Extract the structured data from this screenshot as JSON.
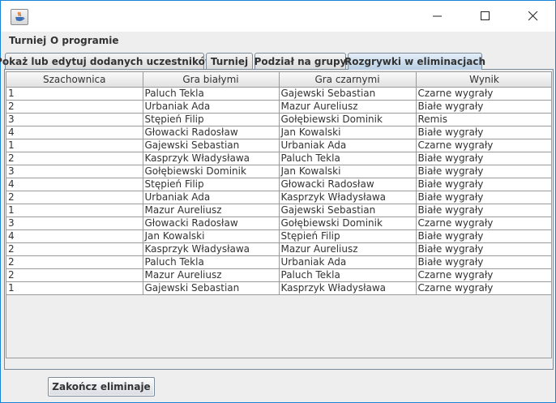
{
  "window": {
    "title": "",
    "icon": "java-cup-icon"
  },
  "menu": {
    "items": [
      "Turniej",
      "O programie"
    ]
  },
  "tabs": [
    {
      "label": "Pokaż lub edytuj dodanych uczestników",
      "active": false
    },
    {
      "label": "Turniej",
      "active": false
    },
    {
      "label": "Podział na grupy",
      "active": false
    },
    {
      "label": "Rozgrywki w eliminacjach",
      "active": true
    }
  ],
  "table": {
    "columns": [
      "Szachownica",
      "Gra białymi",
      "Gra czarnymi",
      "Wynik"
    ],
    "rows": [
      [
        "1",
        "Paluch Tekla",
        "Gajewski Sebastian",
        "Czarne wygrały"
      ],
      [
        "2",
        "Urbaniak Ada",
        "Mazur Aureliusz",
        "Białe wygrały"
      ],
      [
        "3",
        "Stępień Filip",
        "Gołębiewski Dominik",
        "Remis"
      ],
      [
        "4",
        "Głowacki Radosław",
        "Jan Kowalski",
        "Białe wygrały"
      ],
      [
        "1",
        "Gajewski Sebastian",
        "Urbaniak Ada",
        "Czarne wygrały"
      ],
      [
        "2",
        "Kasprzyk Władysława",
        "Paluch Tekla",
        "Białe wygrały"
      ],
      [
        "3",
        "Gołębiewski Dominik",
        "Jan Kowalski",
        "Białe wygrały"
      ],
      [
        "4",
        "Stępień Filip",
        "Głowacki Radosław",
        "Białe wygrały"
      ],
      [
        "2",
        "Urbaniak Ada",
        "Kasprzyk Władysława",
        "Białe wygrały"
      ],
      [
        "1",
        "Mazur Aureliusz",
        "Gajewski Sebastian",
        "Białe wygrały"
      ],
      [
        "3",
        "Głowacki Radosław",
        "Gołębiewski Dominik",
        "Czarne wygrały"
      ],
      [
        "4",
        "Jan Kowalski",
        "Stępień Filip",
        "Białe wygrały"
      ],
      [
        "2",
        "Kasprzyk Władysława",
        "Mazur Aureliusz",
        "Białe wygrały"
      ],
      [
        "2",
        "Paluch Tekla",
        "Urbaniak Ada",
        "Białe wygrały"
      ],
      [
        "2",
        "Mazur Aureliusz",
        "Paluch Tekla",
        "Czarne wygrały"
      ],
      [
        "1",
        "Gajewski Sebastian",
        "Kasprzyk Władysława",
        "Czarne wygrały"
      ]
    ]
  },
  "actions": {
    "finish_label": "Zakończ eliminaje"
  },
  "colors": {
    "window_border": "#1883d7",
    "active_tab": "#b8cfe5",
    "grid_line": "#9a9a9a",
    "panel_bg": "#eeeeee"
  }
}
